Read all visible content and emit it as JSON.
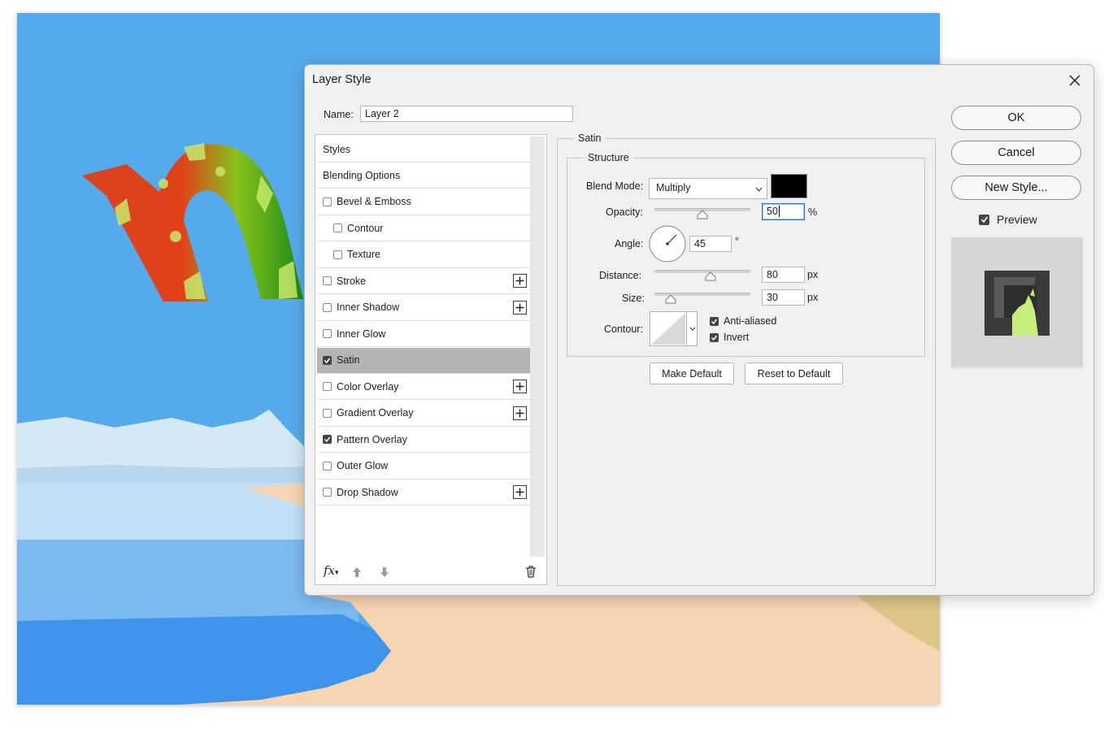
{
  "dialog": {
    "title": "Layer Style",
    "name_label": "Name:",
    "name_value": "Layer 2"
  },
  "styles": {
    "header": "Styles",
    "items": [
      {
        "label": "Blending Options",
        "checkbox": false,
        "checked": false,
        "indent": false,
        "plus": false,
        "selected": false
      },
      {
        "label": "Bevel & Emboss",
        "checkbox": true,
        "checked": false,
        "indent": false,
        "plus": false,
        "selected": false
      },
      {
        "label": "Contour",
        "checkbox": true,
        "checked": false,
        "indent": true,
        "plus": false,
        "selected": false
      },
      {
        "label": "Texture",
        "checkbox": true,
        "checked": false,
        "indent": true,
        "plus": false,
        "selected": false
      },
      {
        "label": "Stroke",
        "checkbox": true,
        "checked": false,
        "indent": false,
        "plus": true,
        "selected": false
      },
      {
        "label": "Inner Shadow",
        "checkbox": true,
        "checked": false,
        "indent": false,
        "plus": true,
        "selected": false
      },
      {
        "label": "Inner Glow",
        "checkbox": true,
        "checked": false,
        "indent": false,
        "plus": false,
        "selected": false
      },
      {
        "label": "Satin",
        "checkbox": true,
        "checked": true,
        "indent": false,
        "plus": false,
        "selected": true
      },
      {
        "label": "Color Overlay",
        "checkbox": true,
        "checked": false,
        "indent": false,
        "plus": true,
        "selected": false
      },
      {
        "label": "Gradient Overlay",
        "checkbox": true,
        "checked": false,
        "indent": false,
        "plus": true,
        "selected": false
      },
      {
        "label": "Pattern Overlay",
        "checkbox": true,
        "checked": true,
        "indent": false,
        "plus": false,
        "selected": false
      },
      {
        "label": "Outer Glow",
        "checkbox": true,
        "checked": false,
        "indent": false,
        "plus": false,
        "selected": false
      },
      {
        "label": "Drop Shadow",
        "checkbox": true,
        "checked": false,
        "indent": false,
        "plus": true,
        "selected": false
      }
    ],
    "fx_label": "fx"
  },
  "satin": {
    "group_title": "Satin",
    "structure_title": "Structure",
    "blend_mode_label": "Blend Mode:",
    "blend_mode_value": "Multiply",
    "satin_color": "#000000",
    "opacity_label": "Opacity:",
    "opacity_value": "50",
    "opacity_unit": "%",
    "angle_label": "Angle:",
    "angle_value": "45",
    "angle_unit": "°",
    "distance_label": "Distance:",
    "distance_value": "80",
    "distance_unit": "px",
    "size_label": "Size:",
    "size_value": "30",
    "size_unit": "px",
    "contour_label": "Contour:",
    "anti_aliased_label": "Anti-aliased",
    "anti_aliased_checked": true,
    "invert_label": "Invert",
    "invert_checked": true,
    "make_default_label": "Make Default",
    "reset_default_label": "Reset to Default"
  },
  "actions": {
    "ok_label": "OK",
    "cancel_label": "Cancel",
    "new_style_label": "New Style...",
    "preview_label": "Preview",
    "preview_checked": true
  },
  "colors": {
    "sky": "#55aaeb",
    "sand": "#f6d5b2",
    "selected_row": "#b4b4b4"
  }
}
